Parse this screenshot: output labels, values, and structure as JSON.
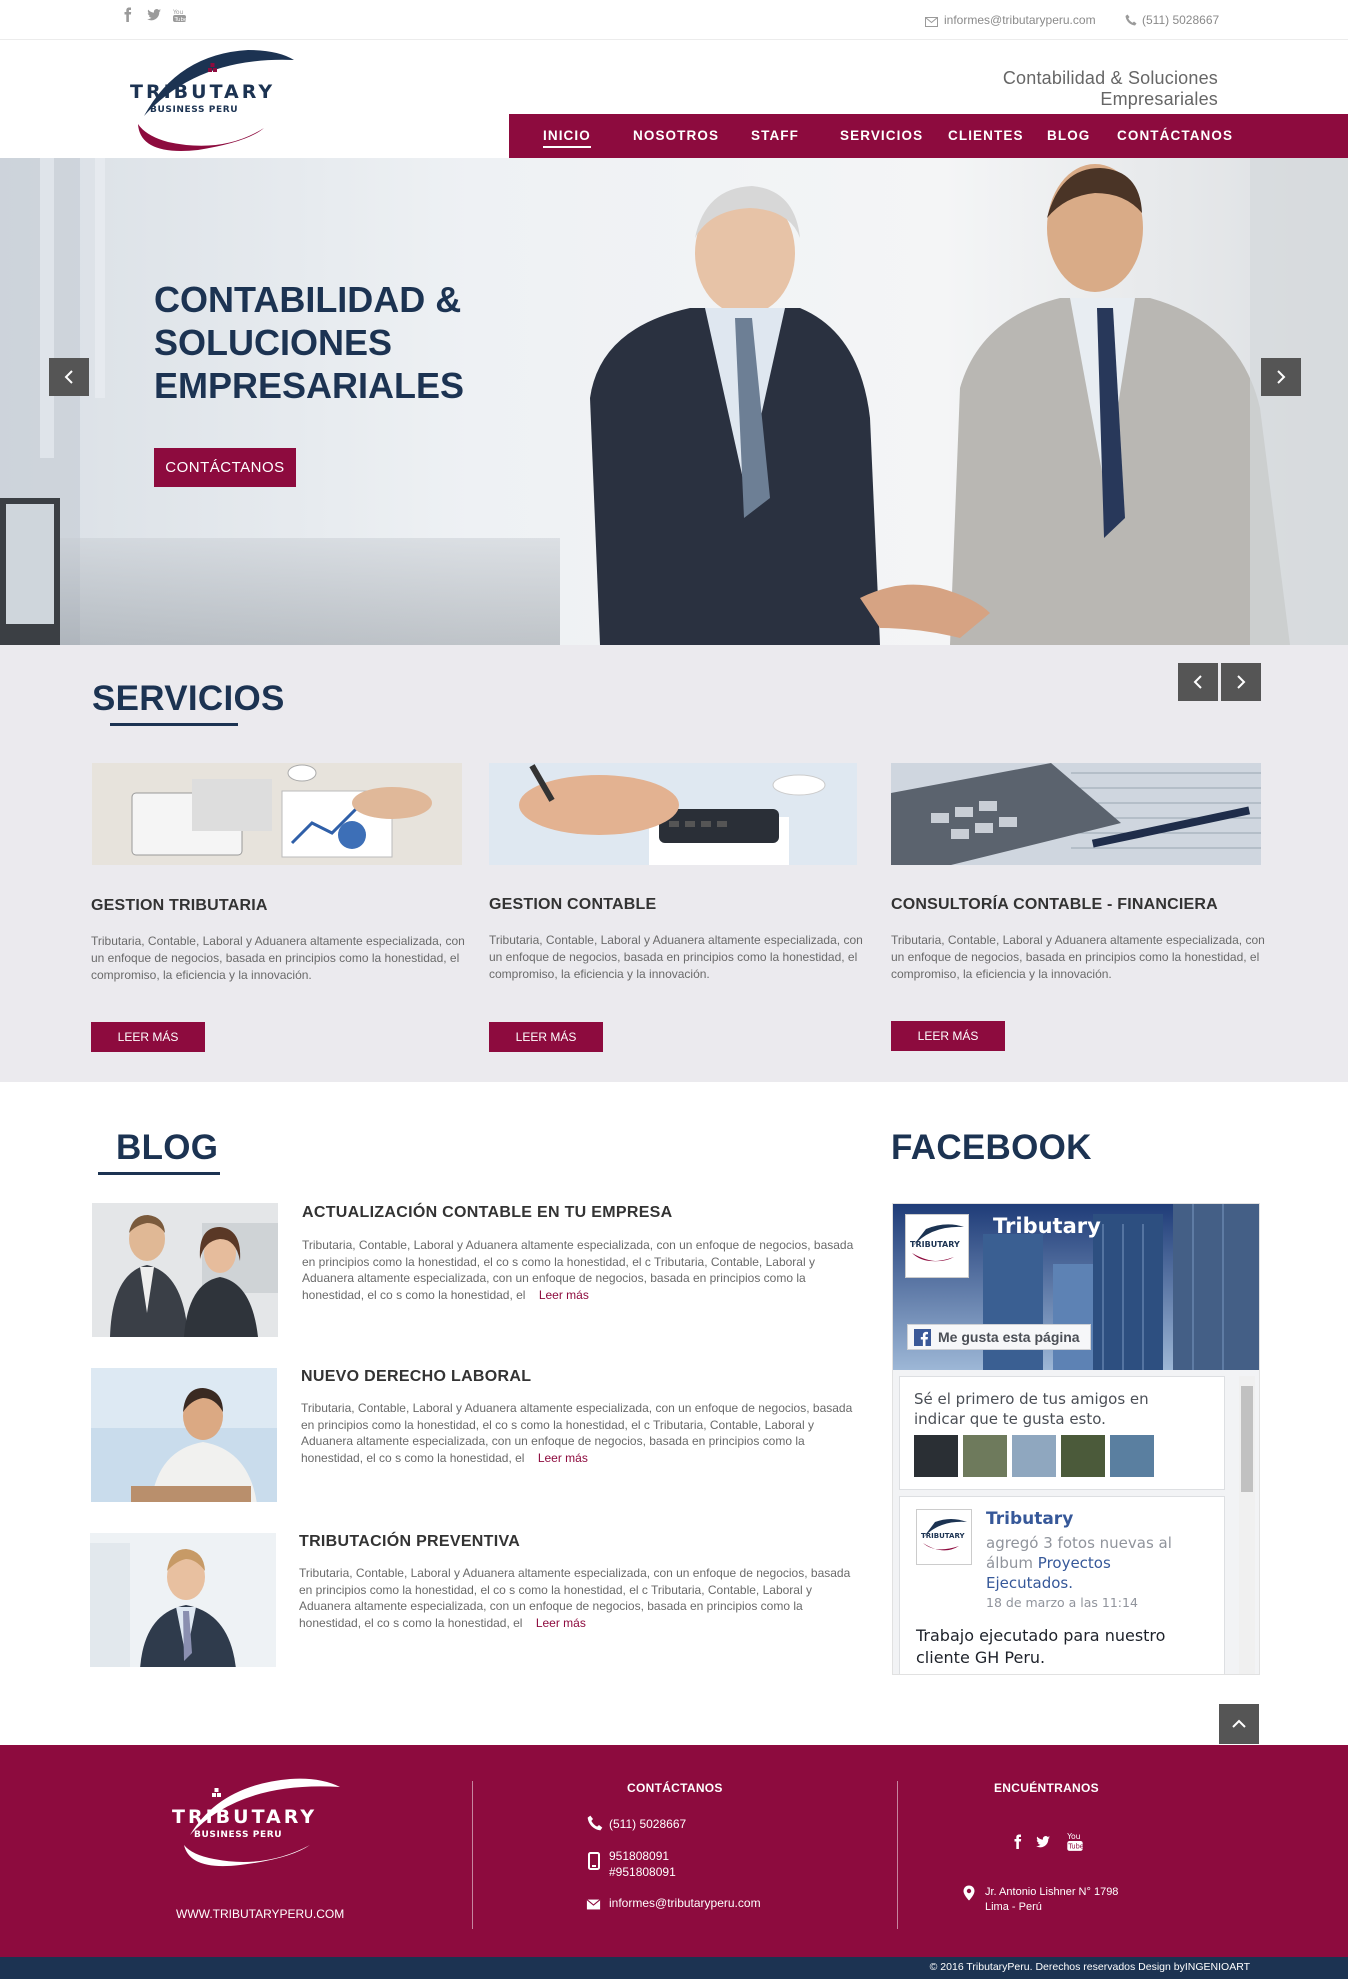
{
  "topbar": {
    "social": [
      "facebook-icon",
      "twitter-icon",
      "youtube-icon"
    ],
    "email": "informes@tributaryperu.com",
    "phone": "(511) 5028667"
  },
  "header": {
    "logo_text": "TRIBUTARY",
    "logo_sub": "BUSINESS PERU",
    "tagline": "Contabilidad & Soluciones Empresariales"
  },
  "nav": {
    "items": [
      {
        "label": "INICIO",
        "active": true
      },
      {
        "label": "NOSOTROS"
      },
      {
        "label": "STAFF"
      },
      {
        "label": "SERVICIOS"
      },
      {
        "label": "CLIENTES"
      },
      {
        "label": "BLOG"
      },
      {
        "label": "CONTÁCTANOS"
      }
    ]
  },
  "hero": {
    "title_lines": [
      "CONTABILIDAD &",
      "SOLUCIONES",
      "EMPRESARIALES"
    ],
    "button": "CONTÁCTANOS"
  },
  "servicios": {
    "title": "SERVICIOS",
    "cards": [
      {
        "title": "GESTION TRIBUTARIA",
        "text": "Tributaria, Contable, Laboral y Aduanera altamente especializada, con un enfoque de negocios, basada en principios como la honestidad, el compromiso, la eficiencia y la innovación.",
        "button": "LEER MÁS"
      },
      {
        "title": "GESTION CONTABLE",
        "text": "Tributaria, Contable, Laboral y Aduanera altamente especializada, con un enfoque de negocios, basada en principios como la honestidad, el compromiso, la eficiencia y la innovación.",
        "button": "LEER MÁS"
      },
      {
        "title": "CONSULTORÍA CONTABLE - FINANCIERA",
        "text": "Tributaria, Contable, Laboral y Aduanera altamente especializada, con un enfoque de negocios, basada en principios como la honestidad, el compromiso, la eficiencia y la innovación.",
        "button": "LEER MÁS"
      }
    ]
  },
  "blog": {
    "title": "BLOG",
    "posts": [
      {
        "title": "ACTUALIZACIÓN CONTABLE EN TU EMPRESA",
        "text": "Tributaria, Contable, Laboral y Aduanera altamente especializada, con un enfoque de negocios, basada en principios como la honestidad, el co  s como la honestidad, el c   Tributaria, Contable, Laboral y Aduanera altamente especializada, con un enfoque de negocios, basada en principios como la honestidad, el co  s como la honestidad, el",
        "more": "Leer más"
      },
      {
        "title": "NUEVO DERECHO LABORAL",
        "text": "Tributaria, Contable, Laboral y Aduanera altamente especializada, con un enfoque de negocios, basada en principios como la honestidad, el co  s como la honestidad, el c   Tributaria, Contable, Laboral y Aduanera altamente especializada, con un enfoque de negocios, basada en principios como la honestidad, el co  s como la honestidad, el",
        "more": "Leer más"
      },
      {
        "title": "TRIBUTACIÓN  PREVENTIVA",
        "text": "Tributaria, Contable, Laboral y Aduanera altamente especializada, con un enfoque de negocios, basada en principios como la honestidad, el co  s como la honestidad, el c   Tributaria, Contable, Laboral y Aduanera altamente especializada, con un enfoque de negocios, basada en principios como la honestidad, el co  s como la honestidad, el",
        "more": "Leer más"
      }
    ]
  },
  "facebook": {
    "title": "FACEBOOK",
    "page_name": "Tributary",
    "like_button": "Me gusta esta página",
    "friends_text": "Sé el primero de tus amigos en indicar que te gusta esto.",
    "post_author": "Tributary",
    "post_action": "agregó 3 fotos nuevas al álbum",
    "post_album": "Proyectos Ejecutados.",
    "post_date": "18 de marzo a las 11:14",
    "post_body": "Trabajo ejecutado para nuestro cliente GH Peru."
  },
  "footer": {
    "logo_text": "TRIBUTARY",
    "logo_sub": "BUSINESS PERU",
    "website": "WWW.TRIBUTARYPERU.COM",
    "contact_title": "CONTÁCTANOS",
    "phone": "(511) 5028667",
    "mobile1": "951808091",
    "mobile2": "#951808091",
    "email": "informes@tributaryperu.com",
    "find_title": "ENCUÉNTRANOS",
    "address1": "Jr. Antonio Lishner N° 1798",
    "address2": "Lima - Perú",
    "copyright": "© 2016  TributaryPeru. Derechos reservados Design byINGENIOART"
  },
  "colors": {
    "brand": "#8d0b3e",
    "navy": "#1c3352",
    "section_bg": "#ebeaee"
  }
}
